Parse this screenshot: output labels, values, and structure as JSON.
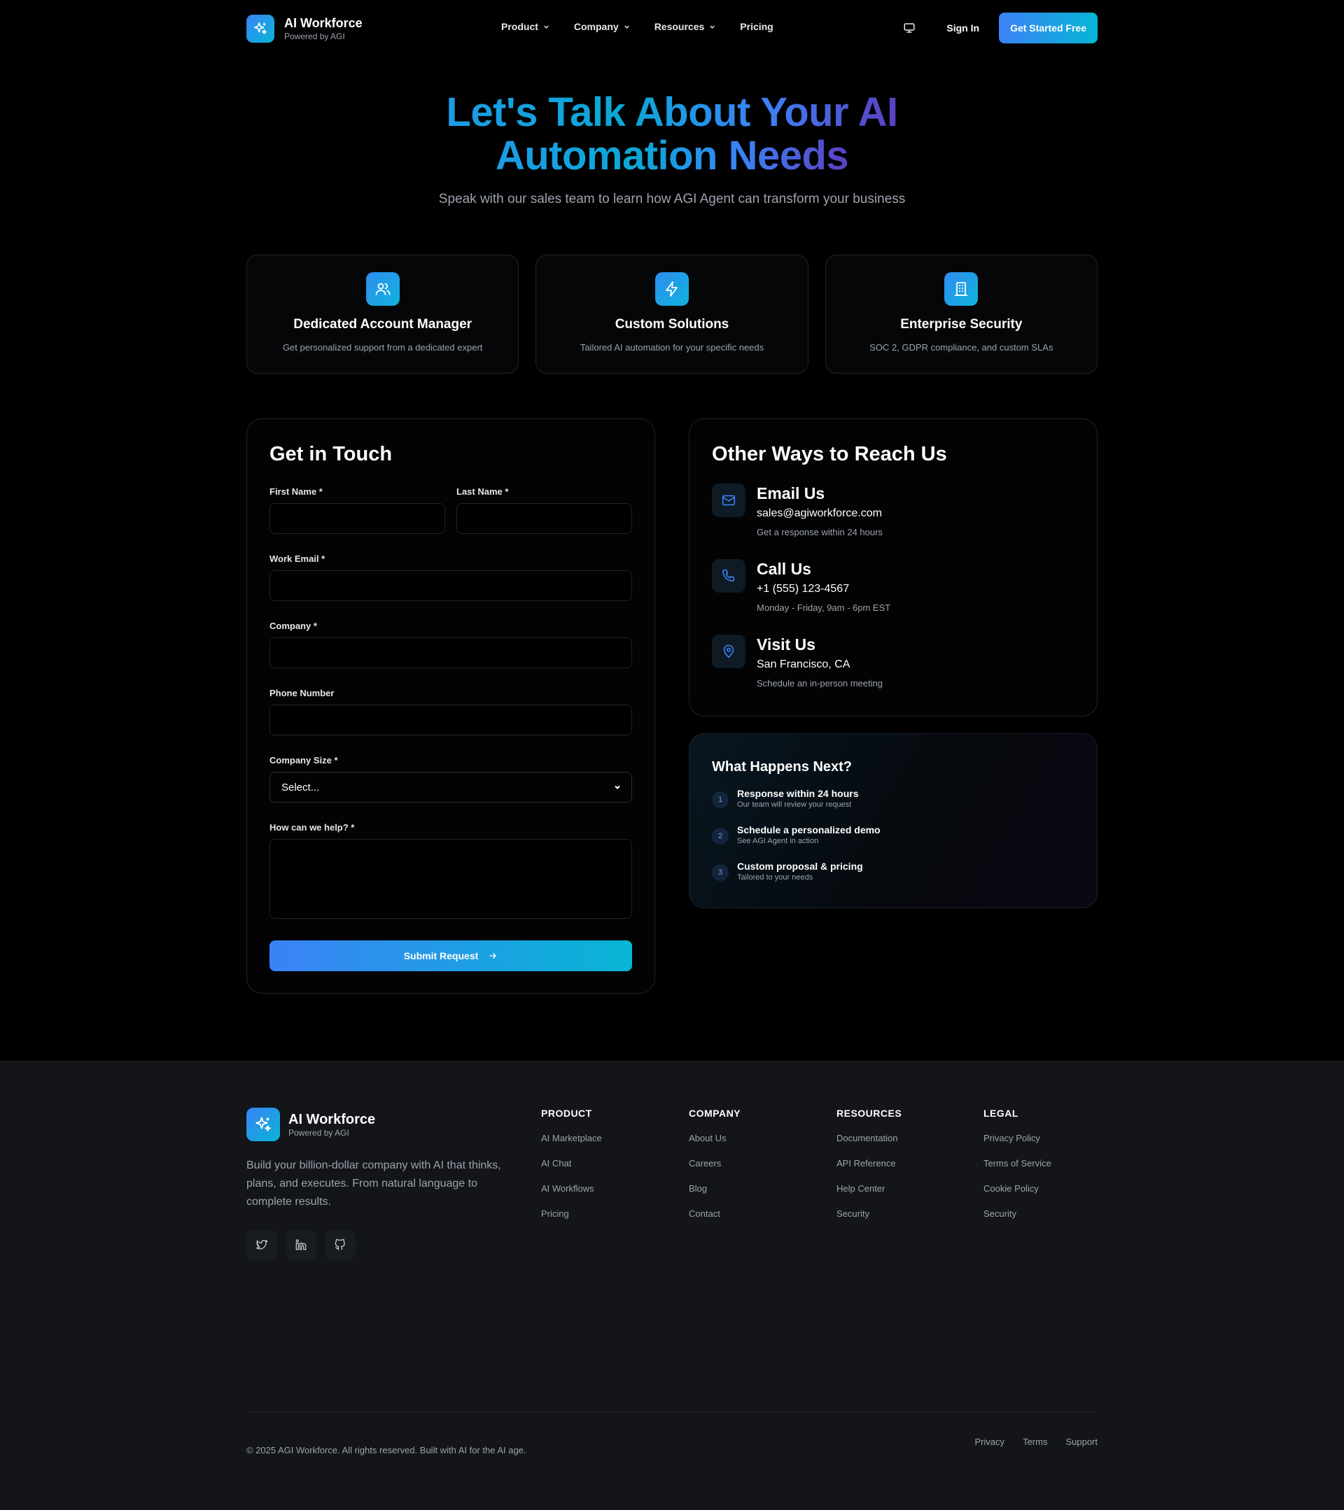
{
  "nav": {
    "brand_name": "AI Workforce",
    "brand_sub": "Powered by AGI",
    "links": [
      {
        "label": "Product",
        "dropdown": true
      },
      {
        "label": "Company",
        "dropdown": true
      },
      {
        "label": "Resources",
        "dropdown": true
      },
      {
        "label": "Pricing",
        "dropdown": false
      }
    ],
    "sign_in": "Sign In",
    "cta": "Get Started Free"
  },
  "hero": {
    "title_line1": "Let's Talk About Your AI",
    "title_line2": "Automation Needs",
    "subtitle": "Speak with our sales team to learn how AGI Agent can transform your business"
  },
  "features": [
    {
      "icon": "users-icon",
      "title": "Dedicated Account Manager",
      "desc": "Get personalized support from a dedicated expert"
    },
    {
      "icon": "lightning-icon",
      "title": "Custom Solutions",
      "desc": "Tailored AI automation for your specific needs"
    },
    {
      "icon": "building-icon",
      "title": "Enterprise Security",
      "desc": "SOC 2, GDPR compliance, and custom SLAs"
    }
  ],
  "form": {
    "heading": "Get in Touch",
    "first_name_label": "First Name *",
    "last_name_label": "Last Name *",
    "email_label": "Work Email *",
    "company_label": "Company *",
    "phone_label": "Phone Number",
    "size_label": "Company Size *",
    "size_selected": "Select...",
    "help_label": "How can we help? *",
    "submit": "Submit Request"
  },
  "contact": {
    "heading": "Other Ways to Reach Us",
    "items": [
      {
        "icon": "mail-icon",
        "title": "Email Us",
        "value": "sales@agiworkforce.com",
        "note": "Get a response within 24 hours"
      },
      {
        "icon": "phone-icon",
        "title": "Call Us",
        "value": "+1 (555) 123-4567",
        "note": "Monday - Friday, 9am - 6pm EST"
      },
      {
        "icon": "map-pin-icon",
        "title": "Visit Us",
        "value": "San Francisco, CA",
        "note": "Schedule an in-person meeting"
      }
    ]
  },
  "next": {
    "heading": "What Happens Next?",
    "steps": [
      {
        "num": "1",
        "title": "Response within 24 hours",
        "desc": "Our team will review your request"
      },
      {
        "num": "2",
        "title": "Schedule a personalized demo",
        "desc": "See AGI Agent in action"
      },
      {
        "num": "3",
        "title": "Custom proposal & pricing",
        "desc": "Tailored to your needs"
      }
    ]
  },
  "footer": {
    "brand_name": "AI Workforce",
    "brand_sub": "Powered by AGI",
    "desc": "Build your billion-dollar company with AI that thinks, plans, and executes. From natural language to complete results.",
    "columns": [
      {
        "heading": "PRODUCT",
        "links": [
          "AI Marketplace",
          "AI Chat",
          "AI Workflows",
          "Pricing"
        ]
      },
      {
        "heading": "COMPANY",
        "links": [
          "About Us",
          "Careers",
          "Blog",
          "Contact"
        ]
      },
      {
        "heading": "RESOURCES",
        "links": [
          "Documentation",
          "API Reference",
          "Help Center",
          "Security"
        ]
      },
      {
        "heading": "LEGAL",
        "links": [
          "Privacy Policy",
          "Terms of Service",
          "Cookie Policy",
          "Security"
        ]
      }
    ],
    "copyright": "© 2025 AGI Workforce. All rights reserved. Built with AI for the AI age.",
    "bottom_links": [
      "Privacy",
      "Terms",
      "Support"
    ]
  },
  "colors": {
    "accent_start": "#3b82f6",
    "accent_end": "#06b6d4",
    "background": "#000000",
    "footer_bg": "#131518"
  }
}
